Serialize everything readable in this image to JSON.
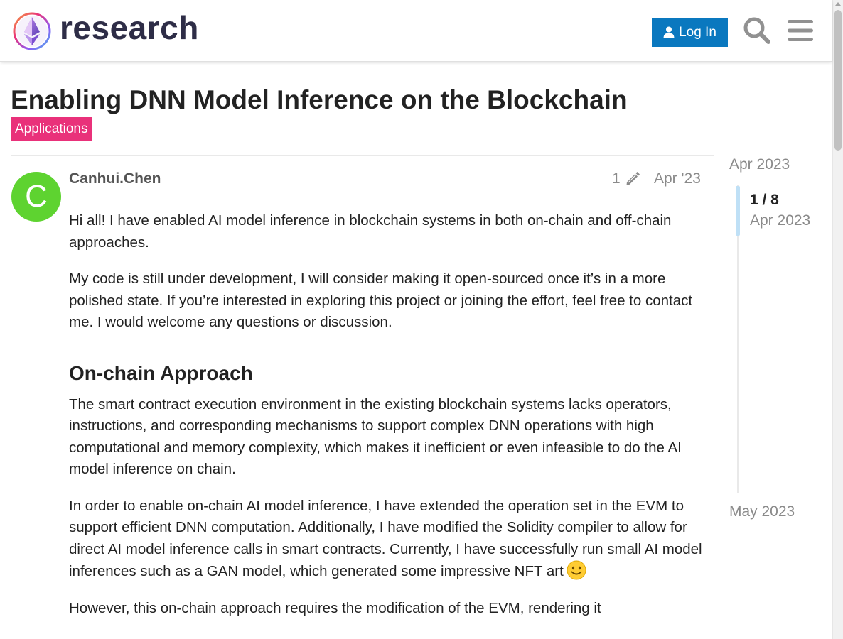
{
  "header": {
    "logo_text": "research",
    "login_label": "Log In",
    "search_icon": "search-icon",
    "menu_icon": "hamburger-menu-icon"
  },
  "topic": {
    "title": "Enabling DNN Model Inference on the Blockchain",
    "category": "Applications",
    "category_color": "#e9317a"
  },
  "post": {
    "avatar_letter": "C",
    "avatar_color": "#5ed330",
    "username": "Canhui.Chen",
    "edit_count": "1",
    "date": "Apr '23",
    "paragraphs": [
      "Hi all! I have enabled AI model inference in blockchain systems in both on-chain and off-chain approaches.",
      "My code is still under development, I will consider making it open-sourced once it’s in a more polished state. If you’re interested in exploring this project or joining the effort, feel free to contact me. I would welcome any questions or discussion."
    ],
    "section_heading": "On-chain Approach",
    "section_paragraphs": [
      "The smart contract execution environment in the existing blockchain systems lacks operators, instructions, and corresponding mechanisms to support complex DNN operations with high computational and memory complexity, which makes it inefficient or even infeasible to do the AI model inference on chain.",
      "In order to enable on-chain AI model inference, I have extended the operation set in the EVM to support efficient DNN computation. Additionally, I have modified the Solidity compiler to allow for direct AI model inference calls in smart contracts. Currently, I have successfully run small AI model inferences such as a GAN model, which generated some impressive NFT art",
      "However, this on-chain approach requires the modification of the EVM, rendering it"
    ]
  },
  "timeline": {
    "start_label": "Apr 2023",
    "position": "1 / 8",
    "current_date": "Apr 2023",
    "end_label": "May 2023"
  },
  "colors": {
    "accent": "#0a78bf",
    "brand_dark": "#2e2d47"
  }
}
